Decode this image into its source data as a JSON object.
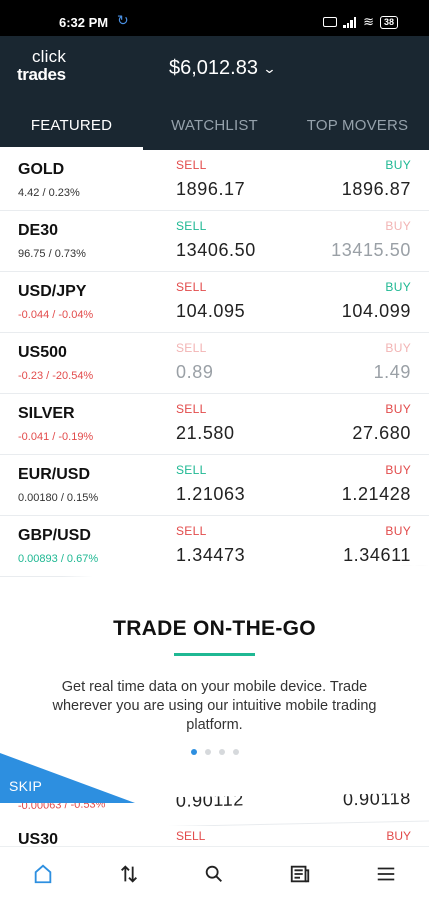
{
  "status_bar": {
    "time": "6:32 PM",
    "battery": "38"
  },
  "header": {
    "logo_line1": "click",
    "logo_line2": "trades",
    "balance": "$6,012.83",
    "tabs": [
      {
        "label": "FEATURED",
        "active": true
      },
      {
        "label": "WATCHLIST",
        "active": false
      },
      {
        "label": "TOP MOVERS",
        "active": false
      }
    ]
  },
  "markets": [
    {
      "symbol": "GOLD",
      "change": "4.42 / 0.23%",
      "sell_label": "SELL",
      "sell": "1896.17",
      "buy_label": "BUY",
      "buy": "1896.87"
    },
    {
      "symbol": "DE30",
      "change": "96.75 / 0.73%",
      "sell_label": "SELL",
      "sell": "13406.50",
      "buy_label": "BUY",
      "buy": "13415.50"
    },
    {
      "symbol": "USD/JPY",
      "change": "-0.044 / -0.04%",
      "sell_label": "SELL",
      "sell": "104.095",
      "buy_label": "BUY",
      "buy": "104.099"
    },
    {
      "symbol": "US500",
      "change": "-0.23 / -20.54%",
      "sell_label": "SELL",
      "sell": "0.89",
      "buy_label": "BUY",
      "buy": "1.49"
    },
    {
      "symbol": "SILVER",
      "change": "-0.041 / -0.19%",
      "sell_label": "SELL",
      "sell": "21.580",
      "buy_label": "BUY",
      "buy": "27.680"
    },
    {
      "symbol": "EUR/USD",
      "change": "0.00180 / 0.15%",
      "sell_label": "SELL",
      "sell": "1.21063",
      "buy_label": "BUY",
      "buy": "1.21428"
    },
    {
      "symbol": "GBP/USD",
      "change": "0.00893 / 0.67%",
      "sell_label": "SELL",
      "sell": "1.34473",
      "buy_label": "BUY",
      "buy": "1.34611"
    }
  ],
  "partial_row": {
    "change": "-0.00063 / -0.53%",
    "sell": "0.90112",
    "buy": "0.90118"
  },
  "partial_row_2": {
    "symbol": "US30",
    "sell_label": "SELL",
    "buy_label": "BUY"
  },
  "onboarding": {
    "title": "TRADE ON-THE-GO",
    "body": "Get real time data on your mobile device. Trade wherever you are using our intuitive mobile trading platform.",
    "skip_label": "SKIP",
    "page_count": 4,
    "current_page": 1
  },
  "colors": {
    "sell_red": "#e24b4b",
    "buy_green": "#1fb893",
    "header_bg": "#1a2731",
    "accent_blue": "#2d8fe0"
  },
  "bottom_nav": [
    "home-icon",
    "swap-arrows-icon",
    "search-icon",
    "news-icon",
    "menu-icon"
  ]
}
